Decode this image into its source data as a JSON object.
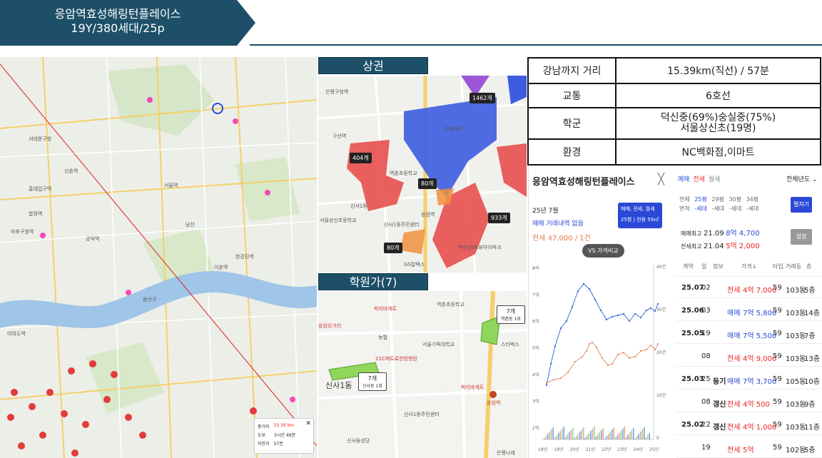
{
  "title": {
    "line1": "응암역효성해링턴플레이스",
    "line2": "19Y/380세대/25p"
  },
  "sections": {
    "commercial": "상권",
    "academy": "학원가(7)"
  },
  "info": [
    {
      "key": "강남까지 거리",
      "value": "15.39km(직선) / 57분"
    },
    {
      "key": "교통",
      "value": "6호선"
    },
    {
      "key": "학군",
      "value": "덕신중(69%)숭실중(75%)",
      "value2": "서울상신초(19명)"
    },
    {
      "key": "환경",
      "value": "NC백화점,이마트"
    }
  ],
  "route_box": {
    "rows": [
      {
        "label": "총거리",
        "value": "15.39 km"
      },
      {
        "label": "도보",
        "value": "3시간 49분"
      },
      {
        "label": "자전거",
        "value": "57분"
      }
    ]
  },
  "map_labels": {
    "a": "서대문구청",
    "b": "이촌역",
    "c": "용산구",
    "d": "여의도역",
    "e": "공덕역",
    "f": "신촌역",
    "g": "홍대입구역",
    "h": "마포구청역",
    "i": "합정역",
    "j": "서울역",
    "k": "남산",
    "l": "한강진역"
  },
  "commercial_map": {
    "tags": [
      "1462개",
      "404개",
      "80개",
      "933개",
      "80개"
    ],
    "labels": [
      "은평구청역",
      "신사1동",
      "응암역",
      "역촌초등학교",
      "신사1동주민센터",
      "백련산SK뷰아이파크",
      "GS칼텍스",
      "서울상신초등학교",
      "은평대로",
      "구산역"
    ]
  },
  "academy_map": {
    "tags": [
      {
        "count": "7개",
        "name": "역촌동 1위"
      },
      {
        "count": "7개",
        "name": "신사동 1위"
      }
    ],
    "labels": [
      "파리바게트",
      "역촌초등학교",
      "서울기독대학교",
      "농협",
      "21C매트로한방병원",
      "신사1동",
      "신사1동주민센터",
      "응암역",
      "파리바게트",
      "스타벅스",
      "신사동성당",
      "은평나래",
      "응암오거리"
    ]
  },
  "tx": {
    "title": "응암역효성해링턴플레이스",
    "month": "25년 7월",
    "no_deal": "매매 거래내역 없음",
    "jeonse": "전세 47,000 / 1건",
    "filter_btn": "매매, 전세, 월세",
    "filter_sub": "25평 | 전용 59㎡",
    "vs_btn": "VS 가격비교",
    "tabs": [
      "매매",
      "전세",
      "월세"
    ],
    "year_select": "전체년도",
    "area_row1": [
      "전체",
      "25평",
      "29평",
      "30평",
      "34평"
    ],
    "area_row2": [
      "면적",
      "-세대",
      "-세대",
      "-세대",
      "-세대"
    ],
    "fold": "펼쳐기",
    "max_sale": {
      "label": "매매최고",
      "date": "21.09",
      "price": "8억 4,700"
    },
    "max_jeonse": {
      "label": "전세최고",
      "date": "21.04",
      "price": "5억 2,000"
    },
    "setting": "설정",
    "headers": [
      "계약",
      "일",
      "정보",
      "가격↓",
      "타입",
      "거래동",
      "층"
    ],
    "rows": [
      {
        "ym": "25.07",
        "d": "02",
        "info": "",
        "type": "전세",
        "price": "4억 7,000",
        "py": "59",
        "dong": "103동",
        "fl": "5층"
      },
      {
        "ym": "25.06",
        "d": "03",
        "info": "",
        "type": "매매",
        "price": "7억 5,800",
        "py": "59",
        "dong": "103동",
        "fl": "14층"
      },
      {
        "ym": "25.05",
        "d": "19",
        "info": "",
        "type": "매매",
        "price": "7억 5,500",
        "py": "59",
        "dong": "103동",
        "fl": "7층"
      },
      {
        "ym": "",
        "d": "08",
        "info": "",
        "type": "전세",
        "price": "4억 9,000",
        "py": "59",
        "dong": "103동",
        "fl": "13층"
      },
      {
        "ym": "25.03",
        "d": "25",
        "info": "등기",
        "type": "매매",
        "price": "7억 3,700",
        "py": "59",
        "dong": "105동",
        "fl": "10층"
      },
      {
        "ym": "",
        "d": "08",
        "info": "갱신",
        "type": "전세",
        "price": "4억 500",
        "py": "59",
        "dong": "103동",
        "fl": "9층"
      },
      {
        "ym": "25.02",
        "d": "22",
        "info": "갱신",
        "type": "전세",
        "price": "4억 1,000",
        "py": "59",
        "dong": "103동",
        "fl": "11층"
      },
      {
        "ym": "",
        "d": "19",
        "info": "",
        "type": "전세",
        "price": "5억",
        "py": "59",
        "dong": "102동",
        "fl": "5층"
      }
    ],
    "chart": {
      "left_ticks": [
        "8억",
        "7억",
        "6억",
        "5억",
        "4억",
        "3억",
        "2억"
      ],
      "right_ticks": [
        "40건",
        "30건",
        "20건",
        "10건",
        "0"
      ],
      "x_ticks": [
        "18년",
        "19년",
        "20년",
        "21년",
        "22년",
        "23년",
        "24년",
        "25년"
      ]
    }
  },
  "colors": {
    "navy": "#1d5068",
    "sale": "#3b6fd6",
    "jeonse": "#e07a45"
  }
}
